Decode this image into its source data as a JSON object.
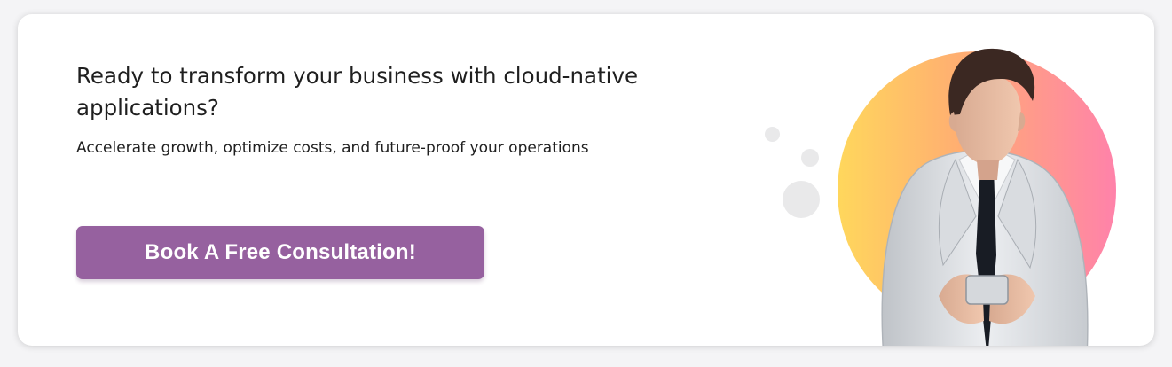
{
  "cta": {
    "heading": "Ready to transform your business with cloud-native applications?",
    "subheading": "Accelerate growth, optimize costs, and future-proof your operations",
    "button_label": "Book A Free Consultation!"
  },
  "colors": {
    "button": "#96619f",
    "gradient_start": "#ffd75c",
    "gradient_end": "#ff82aa",
    "text": "#1f1f1f"
  },
  "icons": {
    "decorative_bubbles": "bubble-decoration-icon"
  }
}
